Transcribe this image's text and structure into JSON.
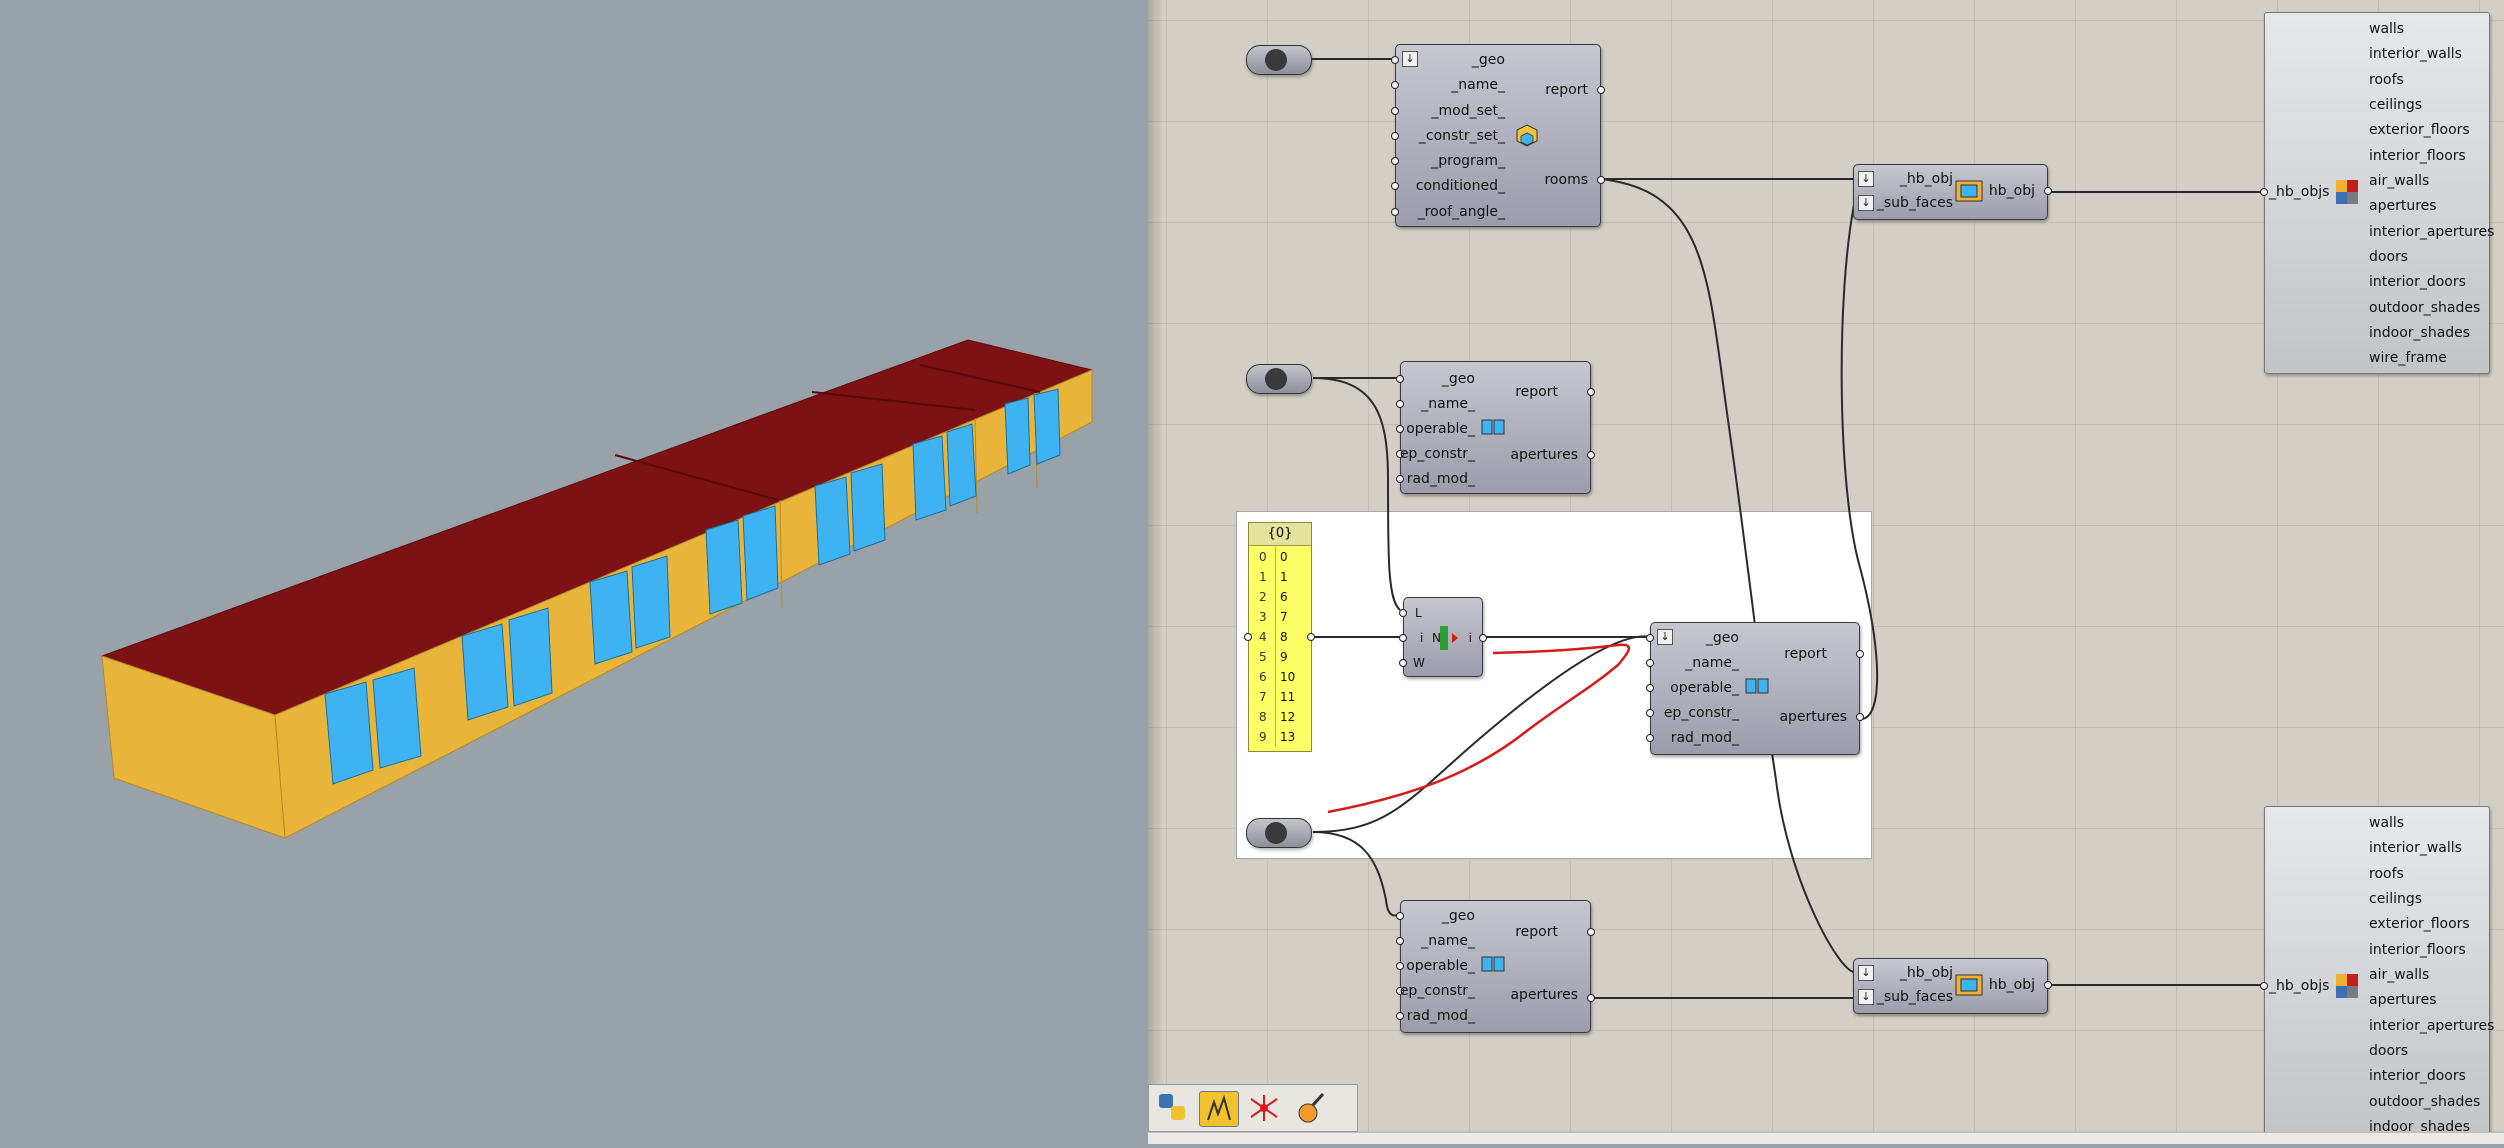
{
  "viewport": {
    "colors": {
      "background": "#99a1a9",
      "roof": "#7d1214",
      "wall": "#e9b43a",
      "window": "#3fb3f1"
    }
  },
  "canvas": {
    "background": "#d3cfc6",
    "room_component": {
      "inputs": [
        "_geo",
        "_name_",
        "_mod_set_",
        "_constr_set_",
        "_program_",
        "conditioned_",
        "_roof_angle_"
      ],
      "outputs": [
        "report",
        "rooms"
      ]
    },
    "aperture_components": [
      {
        "inputs": [
          "_geo",
          "_name_",
          "operable_",
          "ep_constr_",
          "rad_mod_"
        ],
        "outputs": [
          "report",
          "apertures"
        ]
      },
      {
        "inputs": [
          "_geo",
          "_name_",
          "operable_",
          "ep_constr_",
          "rad_mod_"
        ],
        "outputs": [
          "report",
          "apertures"
        ]
      },
      {
        "inputs": [
          "_geo",
          "_name_",
          "operable_",
          "ep_constr_",
          "rad_mod_"
        ],
        "outputs": [
          "report",
          "apertures"
        ]
      }
    ],
    "list_item": {
      "inputs": [
        "L",
        "i",
        "W"
      ],
      "output": "i",
      "center_label": "N"
    },
    "panel": {
      "header": "{0}",
      "rows": [
        {
          "index": "0",
          "value": "0"
        },
        {
          "index": "1",
          "value": "1"
        },
        {
          "index": "2",
          "value": "6"
        },
        {
          "index": "3",
          "value": "7"
        },
        {
          "index": "4",
          "value": "8"
        },
        {
          "index": "5",
          "value": "9"
        },
        {
          "index": "6",
          "value": "10"
        },
        {
          "index": "7",
          "value": "11"
        },
        {
          "index": "8",
          "value": "12"
        },
        {
          "index": "9",
          "value": "13"
        }
      ]
    },
    "add_subface": {
      "inputs": [
        "_hb_obj",
        "_sub_faces"
      ],
      "output": "hb_obj"
    },
    "visualize": {
      "input": "_hb_objs",
      "outputs": [
        "walls",
        "interior_walls",
        "roofs",
        "ceilings",
        "exterior_floors",
        "interior_floors",
        "air_walls",
        "apertures",
        "interior_apertures",
        "doors",
        "interior_doors",
        "outdoor_shades",
        "indoor_shades",
        "wire_frame"
      ]
    },
    "toolbar": {
      "icons": [
        "python-icon",
        "ladybug-icon",
        "plugin-icon",
        "paint-icon"
      ]
    },
    "colors": {
      "annotation": "#d61a1a",
      "wire": "#2a2a2a"
    }
  }
}
